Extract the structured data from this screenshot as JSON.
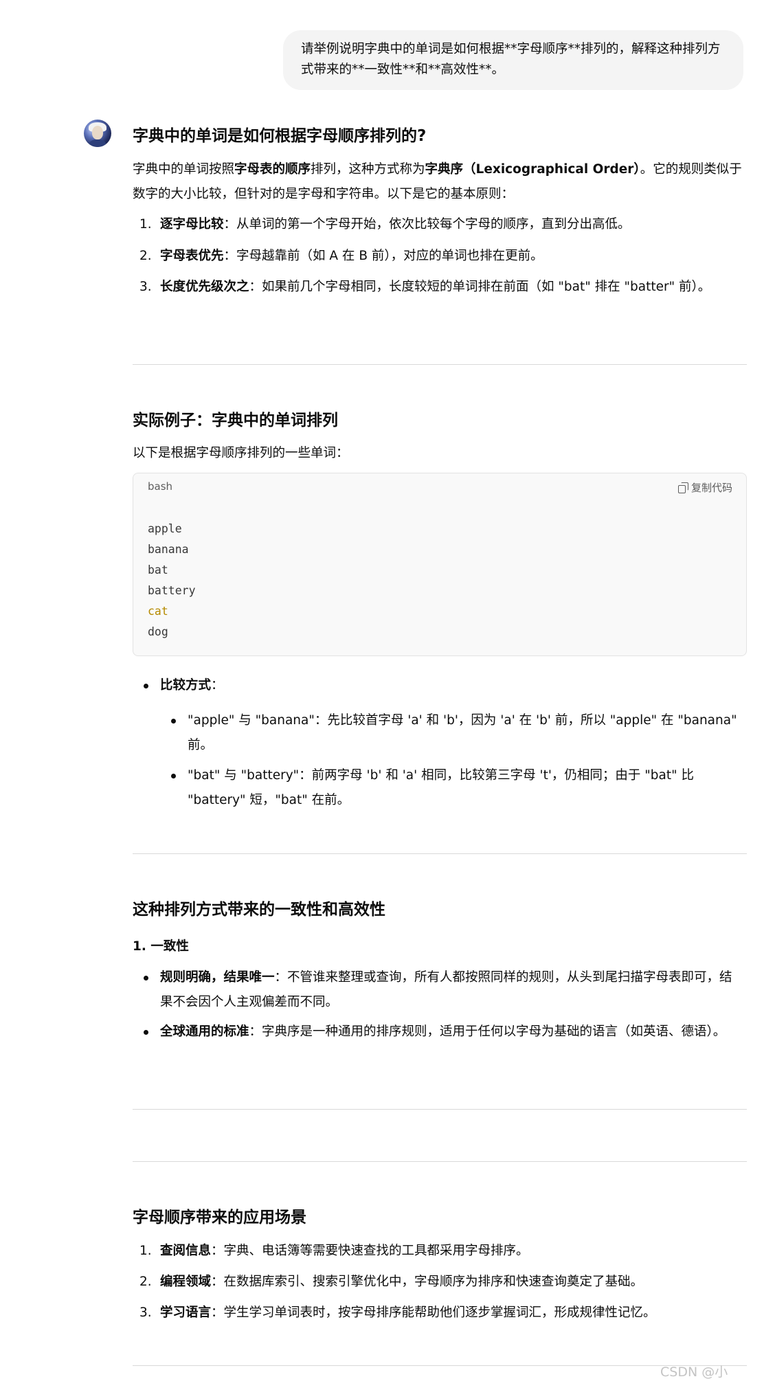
{
  "user_message": "请举例说明字典中的单词是如何根据**字母顺序**排列的，解释这种排列方式带来的**一致性**和**高效性**。",
  "sections": {
    "s1": {
      "title": "字典中的单词是如何根据字母顺序排列的?",
      "intro": {
        "p1": "字典中的单词按照",
        "b1": "字母表的顺序",
        "p2": "排列，这种方式称为",
        "b2": "字典序（Lexicographical Order）",
        "p3": "。它的规则类似于数字的大小比较，但针对的是字母和字符串。以下是它的基本原则："
      },
      "items": [
        {
          "num": "1.",
          "bold": "逐字母比较",
          "text": "：从单词的第一个字母开始，依次比较每个字母的顺序，直到分出高低。"
        },
        {
          "num": "2.",
          "bold": "字母表优先",
          "text": "：字母越靠前（如 A 在 B 前），对应的单词也排在更前。"
        },
        {
          "num": "3.",
          "bold": "长度优先级次之",
          "text": "：如果前几个字母相同，长度较短的单词排在前面（如 \"bat\" 排在 \"batter\" 前）。"
        }
      ]
    },
    "s2": {
      "title": "实际例子：字典中的单词排列",
      "intro": "以下是根据字母顺序排列的一些单词：",
      "code": {
        "lang": "bash",
        "copy_label": "复制代码",
        "lines": [
          "apple",
          "banana",
          "bat",
          "battery",
          "cat",
          "dog"
        ]
      },
      "compare_label": "比较方式",
      "compare_colon": "：",
      "sub_items": [
        {
          "text": "\"apple\" 与 \"banana\"：先比较首字母 'a' 和 'b'，因为 'a' 在 'b' 前，所以 \"apple\" 在 \"banana\" 前。"
        },
        {
          "text": "\"bat\" 与 \"battery\"：前两字母 'b' 和 'a' 相同，比较第三字母 't'，仍相同；由于 \"bat\" 比 \"battery\" 短，\"bat\" 在前。"
        }
      ]
    },
    "s3": {
      "title": "这种排列方式带来的一致性和高效性",
      "subtitle": "1. 一致性",
      "items": [
        {
          "bold": "规则明确，结果唯一",
          "text": "：不管谁来整理或查询，所有人都按照同样的规则，从头到尾扫描字母表即可，结果不会因个人主观偏差而不同。"
        },
        {
          "bold": "全球通用的标准",
          "text": "：字典序是一种通用的排序规则，适用于任何以字母为基础的语言（如英语、德语）。"
        }
      ]
    },
    "s4": {
      "title": "字母顺序带来的应用场景",
      "items": [
        {
          "num": "1.",
          "bold": "查阅信息",
          "text": "：字典、电话簿等需要快速查找的工具都采用字母排序。"
        },
        {
          "num": "2.",
          "bold": "编程领域",
          "text": "：在数据库索引、搜索引擎优化中，字母顺序为排序和快速查询奠定了基础。"
        },
        {
          "num": "3.",
          "bold": "学习语言",
          "text": "：学生学习单词表时，按字母排序能帮助他们逐步掌握词汇，形成规律性记忆。"
        }
      ]
    }
  },
  "watermark": "CSDN @小",
  "colors": {
    "bubble_bg": "#f4f4f4",
    "code_bg": "#f9f9f9",
    "code_keyword": "#b58a00",
    "divider": "#d9d9d9",
    "watermark": "#c4c4c4"
  }
}
